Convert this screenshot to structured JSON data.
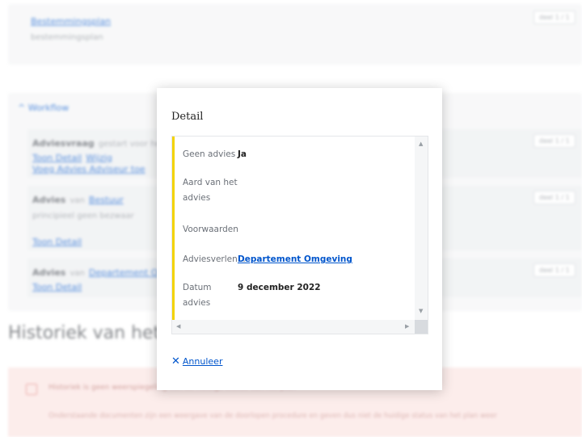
{
  "background": {
    "bouwinfo": {
      "link": "Bestemmingsplan",
      "sub": "bestemmingsplan",
      "badge": "deel 1 / 1"
    },
    "workflow": {
      "title": "Workflow",
      "item1": {
        "title": "Adviesvraag",
        "desc": "gestart voor het plan",
        "link1": "Toon Detail",
        "link2": "Wijzig",
        "link3": "Voeg Advies Adviseur toe",
        "badge": "deel 1 / 1"
      },
      "item2": {
        "title": "Advies",
        "from": "van",
        "source": "Bestuur",
        "desc": "principieel geen bezwaar",
        "link": "Toon Detail",
        "badge": "deel 1 / 1"
      },
      "item3": {
        "title": "Advies",
        "from": "van",
        "source": "Departement Omgeving",
        "link": "Toon Detail",
        "badge": "deel 1 / 1"
      }
    },
    "history_title": "Historiek van het dossier",
    "alert": {
      "line1": "Historiek is geen weerspiegeling van de huidige status van het plan",
      "line2": "Onderstaande documenten zijn een weergave van de doorlopen procedure en geven dus niet de huidige status van het plan weer"
    }
  },
  "modal": {
    "title": "Detail",
    "rows": [
      {
        "label": "Geen advies",
        "value": "Ja"
      },
      {
        "label": "Aard van het advies",
        "value": ""
      },
      {
        "label": "Voorwaarden",
        "value": ""
      },
      {
        "label": "Adviesverlen...",
        "value": "Departement Omgeving"
      },
      {
        "label": "Datum advies",
        "value": "9 december 2022"
      }
    ],
    "cancel_label": "Annuleer",
    "accent_color": "#f3d300",
    "link_color": "#0055cc"
  }
}
